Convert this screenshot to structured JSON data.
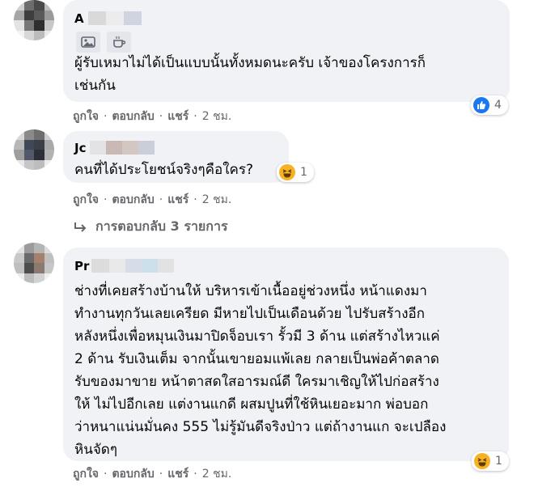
{
  "comments": [
    {
      "author_visible": "A",
      "text": "ผู้รับเหมาไม่ได้เป็นแบบนั้นทั้งหมดนะครับ เจ้าของโครงการก็\nเช่นกัน",
      "actions": {
        "like": "ถูกใจ",
        "reply": "ตอบกลับ",
        "share": "แชร์",
        "time": "2 ชม."
      },
      "reaction": {
        "icon": "like-icon",
        "count": "4",
        "color": "#1877f2"
      }
    },
    {
      "author_visible": "Jc",
      "text": "คนที่ได้ประโยชน์จริงๆคือใคร?",
      "actions": {
        "like": "ถูกใจ",
        "reply": "ตอบกลับ",
        "share": "แชร์",
        "time": "2 ชม."
      },
      "reaction": {
        "icon": "haha-icon",
        "count": "1",
        "color": "#f7b125"
      },
      "replies_link": "การตอบกลับ 3 รายการ"
    },
    {
      "author_visible": "Pr",
      "text": "ช่างที่เคยสร้างบ้านให้ บริหารเข้าเนื้ออยู่ช่วงหนึ่ง หน้าแดงมา\nทำงานทุกวันเลยเครียด มีหายไปเป็นเดือนด้วย ไปรับสร้างอีก\nหลังหนึ่งเพื่อหมุนเงินมาปิดจ็อบเรา รั้วมี 3 ด้าน แต่สร้างไหวแค่\n2 ด้าน รับเงินเต็ม จากนั้นเขายอมแพ้เลย กลายเป็นพ่อค้าตลาด\nรับของมาขาย หน้าตาสดใสอารมณ์ดี ใครมาเชิญให้ไปก่อสร้าง\nให้ ไม่ไปอีกเลย แต่งานแกดี ผสมปูนที่ใช้หินเยอะมาก พ่อบอก\nว่าหนาแน่นมั่นคง 555 ไม่รู้มันดีจริงป่าว แต่ถ้างานแก จะเปลือง\nหินจัดๆ",
      "actions": {
        "like": "ถูกใจ",
        "reply": "ตอบกลับ",
        "share": "แชร์",
        "time": "2 ชม."
      },
      "reaction": {
        "icon": "haha-icon",
        "count": "1",
        "color": "#f7b125"
      }
    }
  ],
  "badges": [
    "photo-icon",
    "coffee-cup-icon"
  ],
  "reply_arrow_icon": "reply-arrow-icon"
}
